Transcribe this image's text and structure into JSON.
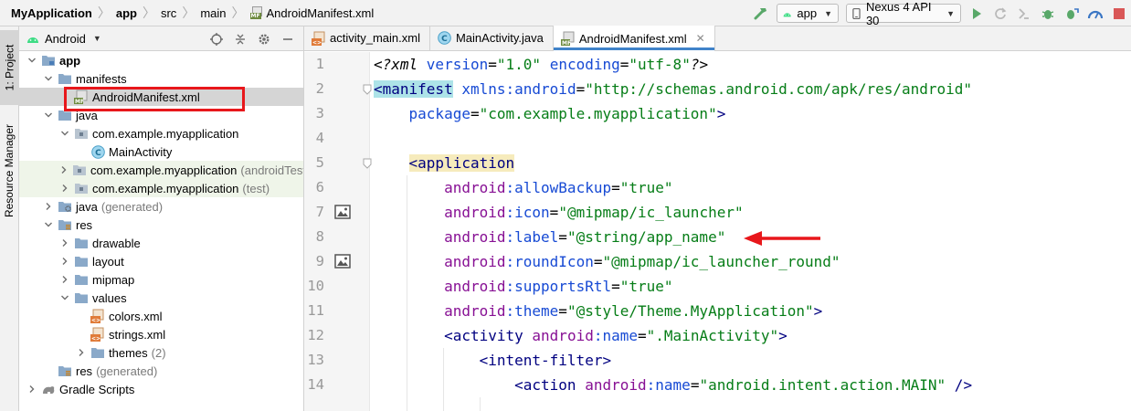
{
  "breadcrumb": {
    "items": [
      {
        "label": "MyApplication",
        "bold": true
      },
      {
        "label": "app",
        "bold": true
      },
      {
        "label": "src",
        "bold": false
      },
      {
        "label": "main",
        "bold": false
      }
    ],
    "file_icon_tag": "MF",
    "file": "AndroidManifest.xml"
  },
  "run_toolbar": {
    "config_label": "app",
    "device_label": "Nexus 4 API 30"
  },
  "tool_windows": {
    "project_tab": "1: Project",
    "resource_tab": "Resource Manager"
  },
  "project_panel": {
    "view_label": "Android",
    "tree": [
      {
        "label": "app",
        "extra": "",
        "depth": 0,
        "expanded": true,
        "icon": "folder-module-icon",
        "bold": true
      },
      {
        "label": "manifests",
        "extra": "",
        "depth": 1,
        "expanded": true,
        "icon": "folder-icon"
      },
      {
        "label": "AndroidManifest.xml",
        "extra": "",
        "depth": 2,
        "leaf": true,
        "icon": "manifest-file-icon",
        "selected": true
      },
      {
        "label": "java",
        "extra": "",
        "depth": 1,
        "expanded": true,
        "icon": "folder-icon"
      },
      {
        "label": "com.example.myapplication",
        "extra": "",
        "depth": 2,
        "expanded": true,
        "icon": "package-icon"
      },
      {
        "label": "MainActivity",
        "extra": "",
        "depth": 3,
        "leaf": true,
        "icon": "class-icon"
      },
      {
        "label": "com.example.myapplication",
        "extra": "(androidTest)",
        "depth": 2,
        "expanded": false,
        "icon": "package-icon",
        "tinted": true
      },
      {
        "label": "com.example.myapplication",
        "extra": "(test)",
        "depth": 2,
        "expanded": false,
        "icon": "package-icon",
        "tinted": true
      },
      {
        "label": "java",
        "extra": "(generated)",
        "depth": 1,
        "expanded": false,
        "icon": "folder-generated-icon"
      },
      {
        "label": "res",
        "extra": "",
        "depth": 1,
        "expanded": true,
        "icon": "folder-res-icon"
      },
      {
        "label": "drawable",
        "extra": "",
        "depth": 2,
        "expanded": false,
        "icon": "folder-icon"
      },
      {
        "label": "layout",
        "extra": "",
        "depth": 2,
        "expanded": false,
        "icon": "folder-icon"
      },
      {
        "label": "mipmap",
        "extra": "",
        "depth": 2,
        "expanded": false,
        "icon": "folder-icon"
      },
      {
        "label": "values",
        "extra": "",
        "depth": 2,
        "expanded": true,
        "icon": "folder-icon"
      },
      {
        "label": "colors.xml",
        "extra": "",
        "depth": 3,
        "leaf": true,
        "icon": "xml-file-icon"
      },
      {
        "label": "strings.xml",
        "extra": "",
        "depth": 3,
        "leaf": true,
        "icon": "xml-file-icon"
      },
      {
        "label": "themes",
        "extra": "(2)",
        "depth": 3,
        "expanded": false,
        "icon": "folder-icon"
      },
      {
        "label": "res",
        "extra": "(generated)",
        "depth": 1,
        "leaf": true,
        "icon": "folder-res-icon"
      },
      {
        "label": "Gradle Scripts",
        "extra": "",
        "depth": 0,
        "expanded": false,
        "icon": "gradle-icon"
      }
    ]
  },
  "editor": {
    "tabs": [
      {
        "label": "activity_main.xml",
        "icon": "xml-file-icon",
        "active": false
      },
      {
        "label": "MainActivity.java",
        "icon": "class-icon",
        "active": false
      },
      {
        "label": "AndroidManifest.xml",
        "icon": "manifest-file-icon",
        "active": true
      }
    ],
    "line_numbers": [
      "1",
      "2",
      "3",
      "4",
      "5",
      "6",
      "7",
      "8",
      "9",
      "10",
      "11",
      "12",
      "13",
      "14"
    ],
    "lines": [
      [
        {
          "t": "<?xml ",
          "c": "c-pi"
        },
        {
          "t": "version",
          "c": "c-attr"
        },
        {
          "t": "=",
          "c": "c-plain"
        },
        {
          "t": "\"1.0\"",
          "c": "c-val"
        },
        {
          "t": " ",
          "c": "c-plain"
        },
        {
          "t": "encoding",
          "c": "c-attr"
        },
        {
          "t": "=",
          "c": "c-plain"
        },
        {
          "t": "\"utf-8\"",
          "c": "c-val"
        },
        {
          "t": "?>",
          "c": "c-pi"
        }
      ],
      [
        {
          "t": "<manifest",
          "c": "c-tag tag-hl"
        },
        {
          "t": " ",
          "c": "c-plain"
        },
        {
          "t": "xmlns:android",
          "c": "c-attr"
        },
        {
          "t": "=",
          "c": "c-plain"
        },
        {
          "t": "\"http://schemas.android.com/apk/res/android\"",
          "c": "c-val"
        }
      ],
      [
        {
          "t": "    ",
          "c": "c-plain"
        },
        {
          "t": "package",
          "c": "c-attr"
        },
        {
          "t": "=",
          "c": "c-plain"
        },
        {
          "t": "\"com.example.myapplication\"",
          "c": "c-val"
        },
        {
          "t": ">",
          "c": "c-tag"
        }
      ],
      [],
      [
        {
          "t": "    ",
          "c": "c-plain"
        },
        {
          "t": "<application",
          "c": "c-tag tag-hl2"
        }
      ],
      [
        {
          "t": "        ",
          "c": "c-plain"
        },
        {
          "t": "android",
          "c": "c-ns"
        },
        {
          "t": ":allowBackup",
          "c": "c-attr"
        },
        {
          "t": "=",
          "c": "c-plain"
        },
        {
          "t": "\"true\"",
          "c": "c-val"
        }
      ],
      [
        {
          "t": "        ",
          "c": "c-plain"
        },
        {
          "t": "android",
          "c": "c-ns"
        },
        {
          "t": ":icon",
          "c": "c-attr"
        },
        {
          "t": "=",
          "c": "c-plain"
        },
        {
          "t": "\"@mipmap/ic_launcher\"",
          "c": "c-val"
        }
      ],
      [
        {
          "t": "        ",
          "c": "c-plain"
        },
        {
          "t": "android",
          "c": "c-ns"
        },
        {
          "t": ":label",
          "c": "c-attr"
        },
        {
          "t": "=",
          "c": "c-plain"
        },
        {
          "t": "\"@string/app_name\"",
          "c": "c-val"
        }
      ],
      [
        {
          "t": "        ",
          "c": "c-plain"
        },
        {
          "t": "android",
          "c": "c-ns"
        },
        {
          "t": ":roundIcon",
          "c": "c-attr"
        },
        {
          "t": "=",
          "c": "c-plain"
        },
        {
          "t": "\"@mipmap/ic_launcher_round\"",
          "c": "c-val"
        }
      ],
      [
        {
          "t": "        ",
          "c": "c-plain"
        },
        {
          "t": "android",
          "c": "c-ns"
        },
        {
          "t": ":supportsRtl",
          "c": "c-attr"
        },
        {
          "t": "=",
          "c": "c-plain"
        },
        {
          "t": "\"true\"",
          "c": "c-val"
        }
      ],
      [
        {
          "t": "        ",
          "c": "c-plain"
        },
        {
          "t": "android",
          "c": "c-ns"
        },
        {
          "t": ":theme",
          "c": "c-attr"
        },
        {
          "t": "=",
          "c": "c-plain"
        },
        {
          "t": "\"@style/Theme.MyApplication\"",
          "c": "c-val"
        },
        {
          "t": ">",
          "c": "c-tag"
        }
      ],
      [
        {
          "t": "        ",
          "c": "c-plain"
        },
        {
          "t": "<activity",
          "c": "c-tag"
        },
        {
          "t": " ",
          "c": "c-plain"
        },
        {
          "t": "android",
          "c": "c-ns"
        },
        {
          "t": ":name",
          "c": "c-attr"
        },
        {
          "t": "=",
          "c": "c-plain"
        },
        {
          "t": "\".MainActivity\"",
          "c": "c-val"
        },
        {
          "t": ">",
          "c": "c-tag"
        }
      ],
      [
        {
          "t": "            ",
          "c": "c-plain"
        },
        {
          "t": "<intent-filter",
          "c": "c-tag"
        },
        {
          "t": ">",
          "c": "c-tag"
        }
      ],
      [
        {
          "t": "                ",
          "c": "c-plain"
        },
        {
          "t": "<action",
          "c": "c-tag"
        },
        {
          "t": " ",
          "c": "c-plain"
        },
        {
          "t": "android",
          "c": "c-ns"
        },
        {
          "t": ":name",
          "c": "c-attr"
        },
        {
          "t": "=",
          "c": "c-plain"
        },
        {
          "t": "\"android.intent.action.MAIN\"",
          "c": "c-val"
        },
        {
          "t": " />",
          "c": "c-tag"
        }
      ]
    ],
    "gutter_image_lines": [
      7,
      9
    ],
    "fold_lines": [
      2,
      5
    ]
  },
  "colors": {
    "annotation_red": "#e8171b",
    "run_green": "#59a869",
    "android_green": "#3ddc84",
    "accent_blue": "#4083c9",
    "folder_blue": "#6fa8dc"
  }
}
